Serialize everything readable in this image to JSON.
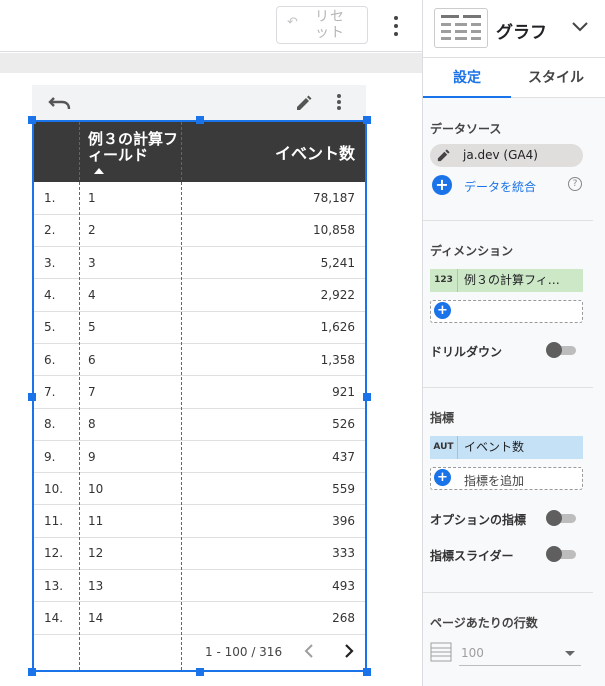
{
  "toolbar": {
    "reset_label": "リセット"
  },
  "table": {
    "dimension_header": "例３の計算フィールド",
    "metric_header": "イベント数",
    "rows": [
      {
        "index": "1.",
        "dim": "1",
        "metric": "78,187"
      },
      {
        "index": "2.",
        "dim": "2",
        "metric": "10,858"
      },
      {
        "index": "3.",
        "dim": "3",
        "metric": "5,241"
      },
      {
        "index": "4.",
        "dim": "4",
        "metric": "2,922"
      },
      {
        "index": "5.",
        "dim": "5",
        "metric": "1,626"
      },
      {
        "index": "6.",
        "dim": "6",
        "metric": "1,358"
      },
      {
        "index": "7.",
        "dim": "7",
        "metric": "921"
      },
      {
        "index": "8.",
        "dim": "8",
        "metric": "526"
      },
      {
        "index": "9.",
        "dim": "9",
        "metric": "437"
      },
      {
        "index": "10.",
        "dim": "10",
        "metric": "559"
      },
      {
        "index": "11.",
        "dim": "11",
        "metric": "396"
      },
      {
        "index": "12.",
        "dim": "12",
        "metric": "333"
      },
      {
        "index": "13.",
        "dim": "13",
        "metric": "493"
      },
      {
        "index": "14.",
        "dim": "14",
        "metric": "268"
      }
    ],
    "pagination": "1 - 100 / 316"
  },
  "panel": {
    "title": "グラフ",
    "tabs": [
      "設定",
      "スタイル"
    ],
    "data_source_label": "データソース",
    "data_source": "ja.dev (GA4)",
    "blend_label": "データを統合",
    "dimension_label": "ディメンション",
    "dimension_tag": "123",
    "dimension_chip": "例３の計算フィ…",
    "drilldown_label": "ドリルダウン",
    "metric_label": "指標",
    "metric_tag": "AUT",
    "metric_chip": "イベント数",
    "add_metric_label": "指標を追加",
    "optional_metrics_label": "オプションの指標",
    "metric_slider_label": "指標スライダー",
    "rows_per_page_label": "ページあたりの行数",
    "rows_per_page_value": "100"
  }
}
